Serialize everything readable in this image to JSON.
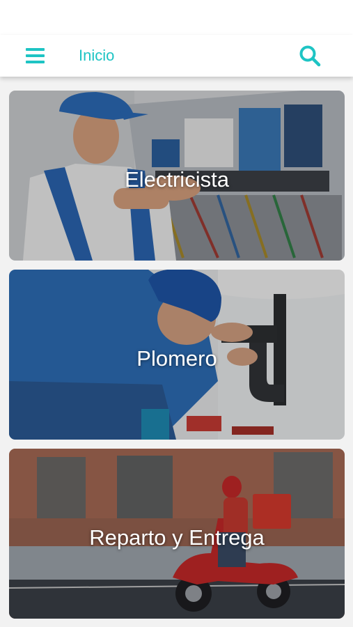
{
  "header": {
    "title": "Inicio",
    "menu_icon": "hamburger-menu-icon",
    "search_icon": "search-icon"
  },
  "colors": {
    "accent": "#1ec4c4",
    "header_background": "#ffffff",
    "page_background": "#f2f2f2"
  },
  "categories": [
    {
      "label": "Electricista"
    },
    {
      "label": "Plomero"
    },
    {
      "label": "Reparto y Entrega"
    }
  ]
}
